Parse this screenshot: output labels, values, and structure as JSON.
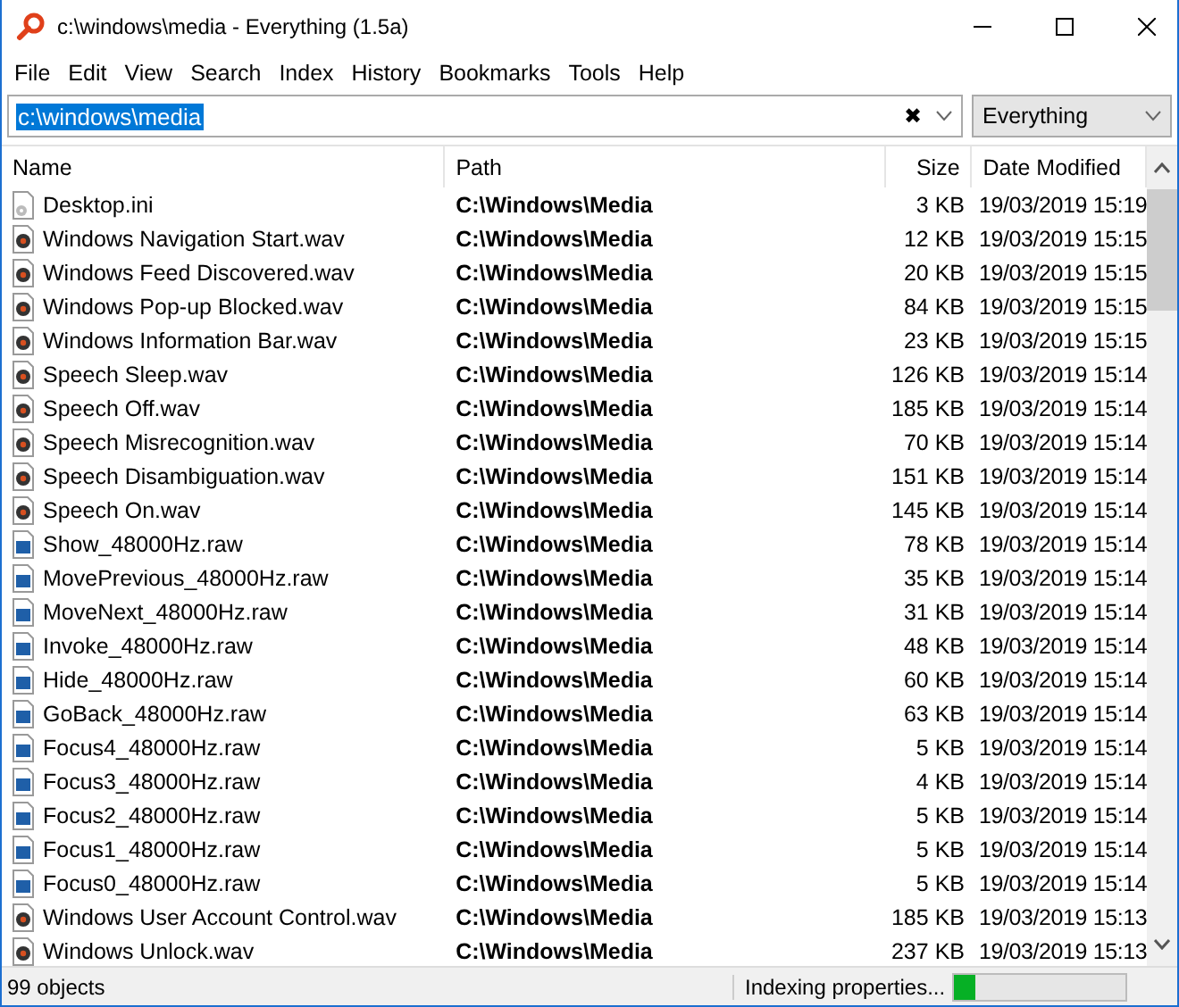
{
  "window": {
    "title": "c:\\windows\\media - Everything (1.5a)"
  },
  "menu": [
    "File",
    "Edit",
    "View",
    "Search",
    "Index",
    "History",
    "Bookmarks",
    "Tools",
    "Help"
  ],
  "search": {
    "value": "c:\\windows\\media",
    "filter": "Everything",
    "clear_icon": "✖"
  },
  "table": {
    "columns": [
      "Name",
      "Path",
      "Size",
      "Date Modified"
    ],
    "rows": [
      {
        "kind": "ini",
        "name": "Desktop.ini",
        "path": "C:\\Windows\\Media",
        "size": "3 KB",
        "date": "19/03/2019 15:19"
      },
      {
        "kind": "wav",
        "name": "Windows Navigation Start.wav",
        "path": "C:\\Windows\\Media",
        "size": "12 KB",
        "date": "19/03/2019 15:15"
      },
      {
        "kind": "wav",
        "name": "Windows Feed Discovered.wav",
        "path": "C:\\Windows\\Media",
        "size": "20 KB",
        "date": "19/03/2019 15:15"
      },
      {
        "kind": "wav",
        "name": "Windows Pop-up Blocked.wav",
        "path": "C:\\Windows\\Media",
        "size": "84 KB",
        "date": "19/03/2019 15:15"
      },
      {
        "kind": "wav",
        "name": "Windows Information Bar.wav",
        "path": "C:\\Windows\\Media",
        "size": "23 KB",
        "date": "19/03/2019 15:15"
      },
      {
        "kind": "wav",
        "name": "Speech Sleep.wav",
        "path": "C:\\Windows\\Media",
        "size": "126 KB",
        "date": "19/03/2019 15:14"
      },
      {
        "kind": "wav",
        "name": "Speech Off.wav",
        "path": "C:\\Windows\\Media",
        "size": "185 KB",
        "date": "19/03/2019 15:14"
      },
      {
        "kind": "wav",
        "name": "Speech Misrecognition.wav",
        "path": "C:\\Windows\\Media",
        "size": "70 KB",
        "date": "19/03/2019 15:14"
      },
      {
        "kind": "wav",
        "name": "Speech Disambiguation.wav",
        "path": "C:\\Windows\\Media",
        "size": "151 KB",
        "date": "19/03/2019 15:14"
      },
      {
        "kind": "wav",
        "name": "Speech On.wav",
        "path": "C:\\Windows\\Media",
        "size": "145 KB",
        "date": "19/03/2019 15:14"
      },
      {
        "kind": "raw",
        "name": "Show_48000Hz.raw",
        "path": "C:\\Windows\\Media",
        "size": "78 KB",
        "date": "19/03/2019 15:14"
      },
      {
        "kind": "raw",
        "name": "MovePrevious_48000Hz.raw",
        "path": "C:\\Windows\\Media",
        "size": "35 KB",
        "date": "19/03/2019 15:14"
      },
      {
        "kind": "raw",
        "name": "MoveNext_48000Hz.raw",
        "path": "C:\\Windows\\Media",
        "size": "31 KB",
        "date": "19/03/2019 15:14"
      },
      {
        "kind": "raw",
        "name": "Invoke_48000Hz.raw",
        "path": "C:\\Windows\\Media",
        "size": "48 KB",
        "date": "19/03/2019 15:14"
      },
      {
        "kind": "raw",
        "name": "Hide_48000Hz.raw",
        "path": "C:\\Windows\\Media",
        "size": "60 KB",
        "date": "19/03/2019 15:14"
      },
      {
        "kind": "raw",
        "name": "GoBack_48000Hz.raw",
        "path": "C:\\Windows\\Media",
        "size": "63 KB",
        "date": "19/03/2019 15:14"
      },
      {
        "kind": "raw",
        "name": "Focus4_48000Hz.raw",
        "path": "C:\\Windows\\Media",
        "size": "5 KB",
        "date": "19/03/2019 15:14"
      },
      {
        "kind": "raw",
        "name": "Focus3_48000Hz.raw",
        "path": "C:\\Windows\\Media",
        "size": "4 KB",
        "date": "19/03/2019 15:14"
      },
      {
        "kind": "raw",
        "name": "Focus2_48000Hz.raw",
        "path": "C:\\Windows\\Media",
        "size": "5 KB",
        "date": "19/03/2019 15:14"
      },
      {
        "kind": "raw",
        "name": "Focus1_48000Hz.raw",
        "path": "C:\\Windows\\Media",
        "size": "5 KB",
        "date": "19/03/2019 15:14"
      },
      {
        "kind": "raw",
        "name": "Focus0_48000Hz.raw",
        "path": "C:\\Windows\\Media",
        "size": "5 KB",
        "date": "19/03/2019 15:14"
      },
      {
        "kind": "wav",
        "name": "Windows User Account Control.wav",
        "path": "C:\\Windows\\Media",
        "size": "185 KB",
        "date": "19/03/2019 15:13"
      },
      {
        "kind": "wav",
        "name": "Windows Unlock.wav",
        "path": "C:\\Windows\\Media",
        "size": "237 KB",
        "date": "19/03/2019 15:13"
      }
    ]
  },
  "status_bar": {
    "count": "99 objects",
    "task": "Indexing properties...",
    "level": 0.12
  }
}
